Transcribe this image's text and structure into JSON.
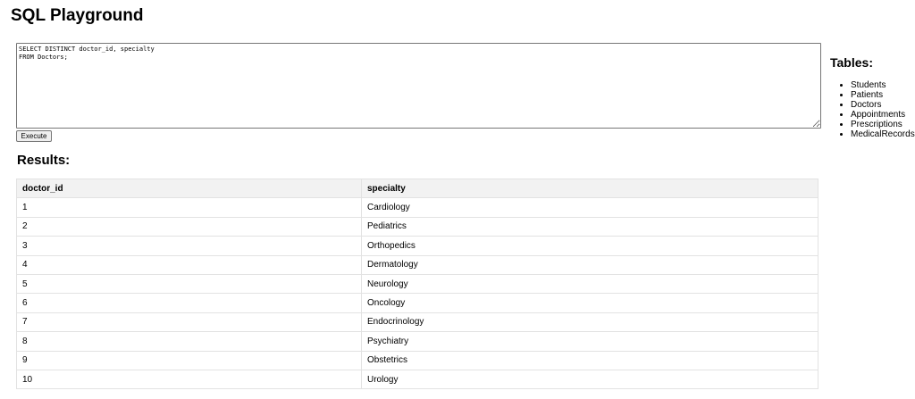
{
  "page": {
    "title": "SQL Playground"
  },
  "editor": {
    "query": "SELECT DISTINCT doctor_id, specialty\nFROM Doctors;",
    "execute_label": "Execute"
  },
  "results": {
    "heading": "Results:",
    "columns": [
      "doctor_id",
      "specialty"
    ],
    "rows": [
      [
        "1",
        "Cardiology"
      ],
      [
        "2",
        "Pediatrics"
      ],
      [
        "3",
        "Orthopedics"
      ],
      [
        "4",
        "Dermatology"
      ],
      [
        "5",
        "Neurology"
      ],
      [
        "6",
        "Oncology"
      ],
      [
        "7",
        "Endocrinology"
      ],
      [
        "8",
        "Psychiatry"
      ],
      [
        "9",
        "Obstetrics"
      ],
      [
        "10",
        "Urology"
      ]
    ]
  },
  "sidebar": {
    "heading": "Tables:",
    "tables": [
      "Students",
      "Patients",
      "Doctors",
      "Appointments",
      "Prescriptions",
      "MedicalRecords"
    ]
  }
}
